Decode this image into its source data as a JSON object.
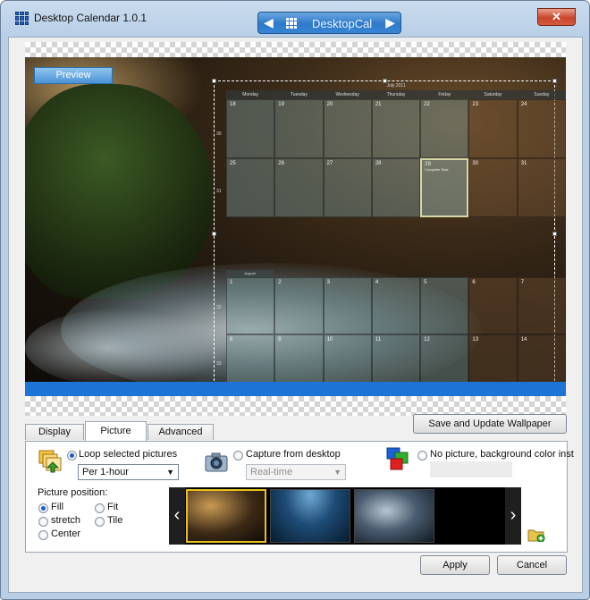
{
  "window": {
    "title": "Desktop Calendar 1.0.1",
    "nav_label": "DesktopCal",
    "close_symbol": "✕"
  },
  "preview": {
    "button_label": "Preview"
  },
  "calendar": {
    "month_title": "July 2011",
    "weekdays": [
      "Monday",
      "Tuesday",
      "Wednesday",
      "Thursday",
      "Friday",
      "Saturday",
      "Sunday"
    ],
    "month_tag": "August",
    "weeks": [
      {
        "num": "30",
        "days": [
          "18",
          "19",
          "20",
          "21",
          "22",
          "23",
          "24"
        ]
      },
      {
        "num": "31",
        "days": [
          "25",
          "26",
          "27",
          "28",
          "29",
          "30",
          "31"
        ]
      },
      {
        "num": "32",
        "days": [
          "1",
          "2",
          "3",
          "4",
          "5",
          "6",
          "7"
        ]
      },
      {
        "num": "33",
        "days": [
          "8",
          "9",
          "10",
          "11",
          "12",
          "13",
          "14"
        ]
      }
    ],
    "today_event": "Complete Task"
  },
  "tabs": [
    "Display",
    "Picture",
    "Advanced"
  ],
  "active_tab": "Picture",
  "save_button": "Save and Update Wallpaper",
  "sources": {
    "loop_label": "Loop selected pictures",
    "loop_interval": "Per 1-hour",
    "capture_label": "Capture from desktop",
    "capture_interval": "Real-time",
    "nocolor_label": "No picture, background color inst"
  },
  "picture_position": {
    "heading": "Picture position:",
    "options": [
      "Fill",
      "Fit",
      "stretch",
      "Tile",
      "Center"
    ],
    "selected": "Fill"
  },
  "footer": {
    "apply": "Apply",
    "cancel": "Cancel"
  },
  "colors": {
    "accent": "#1d74d6",
    "selected_thumb": "#e8c21a"
  }
}
